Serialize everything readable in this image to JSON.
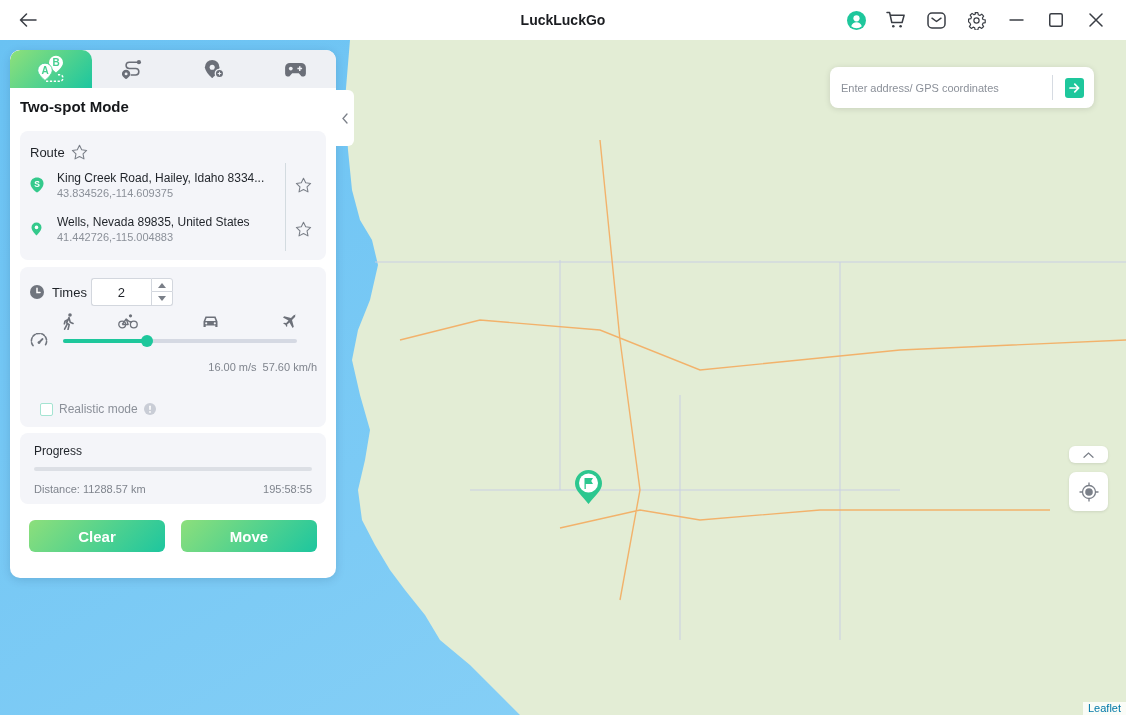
{
  "window": {
    "title": "LuckLuckGo"
  },
  "panel": {
    "tabs": [
      {
        "selected": true,
        "pin_labels": [
          "A",
          "B"
        ]
      },
      {
        "selected": false
      },
      {
        "selected": false
      },
      {
        "selected": false
      }
    ],
    "title": "Two-spot Mode",
    "route": {
      "label": "Route",
      "favorite": false,
      "stops": [
        {
          "kind": "start",
          "badge": "S",
          "address": "King Creek Road, Hailey, Idaho 8334...",
          "coordinates": "43.834526,-114.609375",
          "favorite": false
        },
        {
          "kind": "end",
          "address": "Wells, Nevada 89835, United States",
          "coordinates": "41.442726,-115.004883",
          "favorite": false
        }
      ]
    },
    "speed": {
      "times_label": "Times",
      "times_value": "2",
      "level": 0.36,
      "speed_ms": "16.00 m/s",
      "speed_kmh": "57.60 km/h",
      "realistic_mode": {
        "label": "Realistic mode",
        "checked": false
      }
    },
    "progress": {
      "label": "Progress",
      "distance": "Distance: 11288.57 km",
      "duration": "195:58:55"
    },
    "buttons": [
      "Clear",
      "Move"
    ]
  },
  "map": {
    "search": {
      "placeholder": "Enter address/ GPS coordinates"
    },
    "attribution": "Leaflet"
  }
}
